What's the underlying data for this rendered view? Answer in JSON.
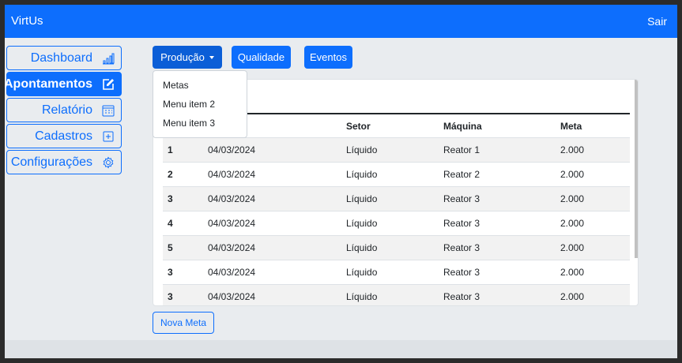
{
  "navbar": {
    "brand": "VirtUs",
    "logout": "Sair"
  },
  "sidebar": {
    "items": [
      {
        "label": "Dashboard",
        "icon": "bar-chart-icon",
        "active": false
      },
      {
        "label": "Apontamentos",
        "icon": "pencil-square-icon",
        "active": true
      },
      {
        "label": "Relatório",
        "icon": "calendar-grid-icon",
        "active": false
      },
      {
        "label": "Cadastros",
        "icon": "plus-square-icon",
        "active": false
      },
      {
        "label": "Configurações",
        "icon": "gear-icon",
        "active": false
      }
    ]
  },
  "toolbar": {
    "producao": "Produção",
    "qualidade": "Qualidade",
    "eventos": "Eventos"
  },
  "dropdown": {
    "items": [
      "Metas",
      "Menu item 2",
      "Menu item 3"
    ]
  },
  "table": {
    "headers": [
      "",
      "",
      "Setor",
      "Máquina",
      "Meta"
    ],
    "rows": [
      [
        "1",
        "04/03/2024",
        "Líquido",
        "Reator 1",
        "2.000"
      ],
      [
        "2",
        "04/03/2024",
        "Líquido",
        "Reator 2",
        "2.000"
      ],
      [
        "3",
        "04/03/2024",
        "Líquido",
        "Reator 3",
        "2.000"
      ],
      [
        "4",
        "04/03/2024",
        "Líquido",
        "Reator 3",
        "2.000"
      ],
      [
        "5",
        "04/03/2024",
        "Líquido",
        "Reator 3",
        "2.000"
      ],
      [
        "3",
        "04/03/2024",
        "Líquido",
        "Reator 3",
        "2.000"
      ],
      [
        "3",
        "04/03/2024",
        "Líquido",
        "Reator 3",
        "2.000"
      ]
    ]
  },
  "actions": {
    "new_goal": "Nova Meta"
  },
  "colors": {
    "primary": "#0d6efd",
    "background": "#e9ecef"
  }
}
